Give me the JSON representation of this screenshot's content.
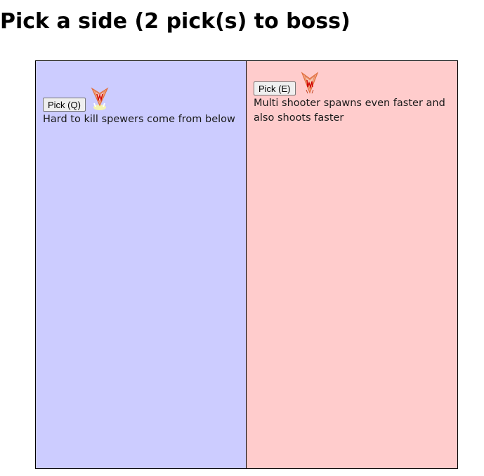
{
  "title": "Pick a side (2 pick(s) to boss)",
  "colors": {
    "left_side": "#ccccff",
    "right_side": "#ffcccc"
  },
  "sides": [
    {
      "button_label": "Pick (Q)",
      "icon": "spewer-enemy-icon",
      "description": "Hard to kill spewers come from below"
    },
    {
      "button_label": "Pick (E)",
      "icon": "multi-shooter-enemy-icon",
      "description": "Multi shooter spawns even faster and also shoots faster"
    }
  ]
}
